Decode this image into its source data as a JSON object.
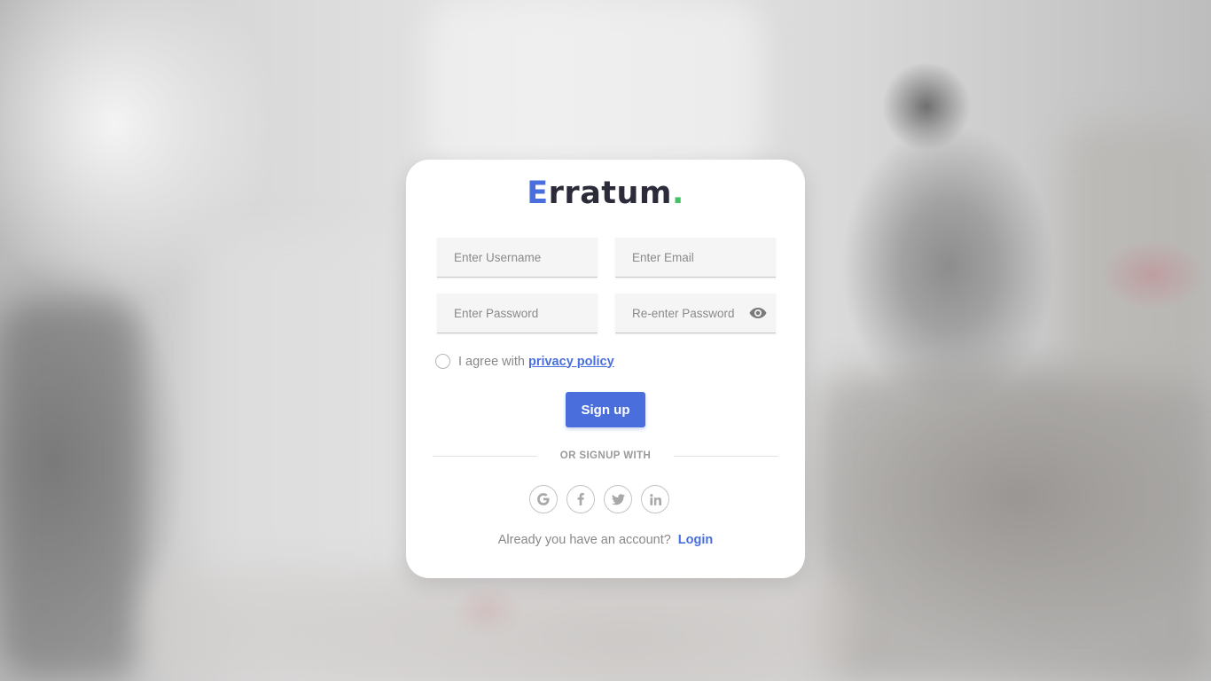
{
  "brand": {
    "first_letter": "E",
    "rest": "rratum",
    "dot": "."
  },
  "form": {
    "username_placeholder": "Enter Username",
    "email_placeholder": "Enter Email",
    "password_placeholder": "Enter Password",
    "repassword_placeholder": "Re-enter Password",
    "agree_text": "I agree with",
    "privacy_link": "privacy policy",
    "signup_label": "Sign up"
  },
  "divider": {
    "text": "OR SIGNUP WITH"
  },
  "socials": [
    {
      "icon": "google-icon",
      "glyph": "G"
    },
    {
      "icon": "facebook-icon",
      "glyph": "f"
    },
    {
      "icon": "twitter-icon",
      "glyph": "t"
    },
    {
      "icon": "linkedin-icon",
      "glyph": "in"
    }
  ],
  "footer": {
    "question": "Already you have an account?",
    "login_link": "Login"
  },
  "colors": {
    "accent": "#4a6fdc",
    "dot": "#46c168"
  }
}
